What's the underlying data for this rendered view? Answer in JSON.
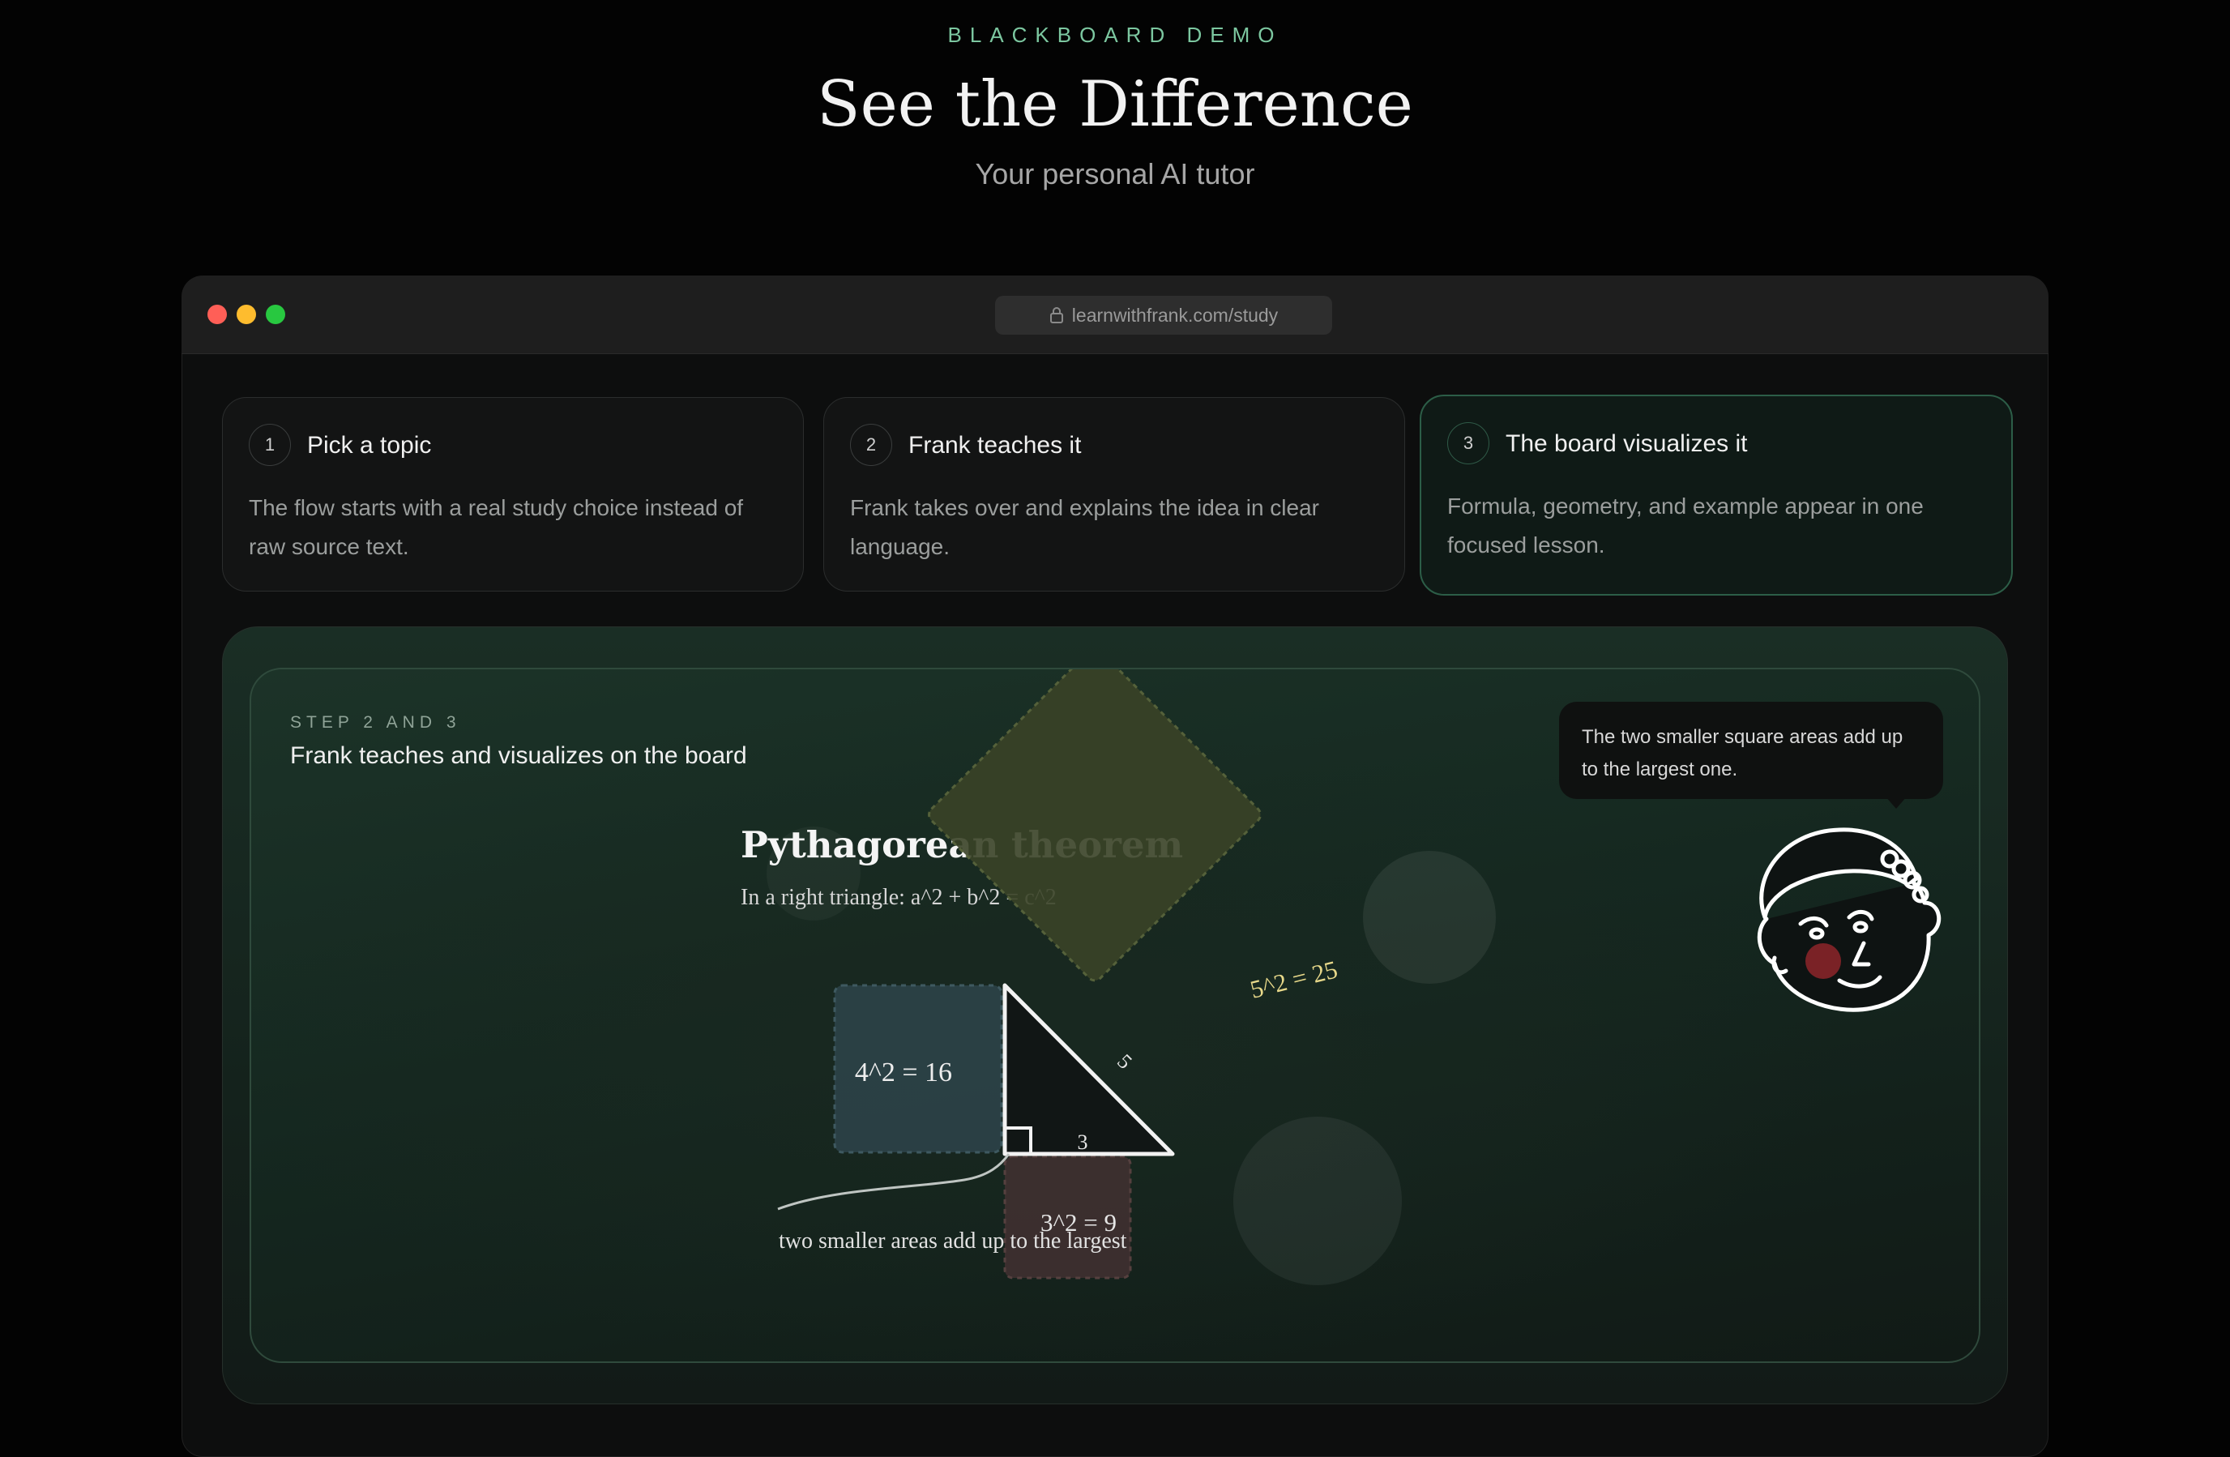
{
  "hero": {
    "eyebrow": "BLACKBOARD DEMO",
    "title": "See the Difference",
    "subtitle": "Your personal AI tutor"
  },
  "browser": {
    "url": "learnwithfrank.com/study"
  },
  "steps": [
    {
      "number": "1",
      "title": "Pick a topic",
      "description": "The flow starts with a real study choice instead of raw source text."
    },
    {
      "number": "2",
      "title": "Frank teaches it",
      "description": "Frank takes over and explains the idea in clear language."
    },
    {
      "number": "3",
      "title": "The board visualizes it",
      "description": "Formula, geometry, and example appear in one focused lesson."
    }
  ],
  "board": {
    "label": "STEP 2 AND 3",
    "heading": "Frank teaches and visualizes on the board",
    "lesson_title": "Pythagorean theorem",
    "lesson_formula": "In a right triangle: a^2 + b^2 = c^2",
    "square_a": "4^2 = 16",
    "square_b": "3^2 = 9",
    "square_c": "5^2 = 25",
    "side_b_label": "3",
    "side_c_label": "5",
    "annotation": "two smaller areas add up to the largest",
    "speech": "The two smaller square areas add up to the largest one."
  },
  "colors": {
    "accent_green": "#7cc7a0",
    "active_border": "#2c5d47",
    "square_a": "#2c4248",
    "square_b": "#3d2f2f",
    "square_c": "#3a4327"
  },
  "icons": {
    "lock": "lock-icon",
    "avatar": "frank-avatar"
  }
}
